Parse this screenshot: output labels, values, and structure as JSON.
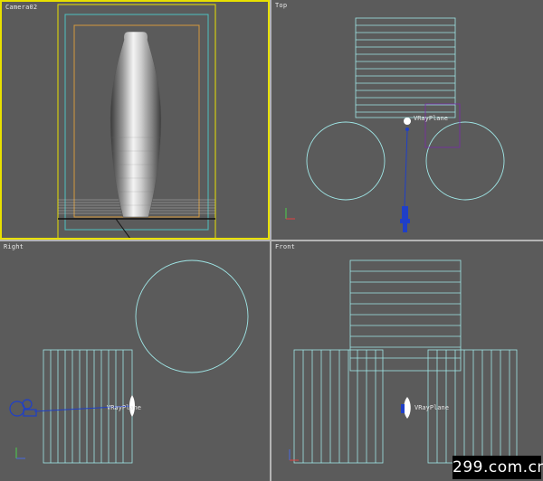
{
  "viewports": {
    "camera": {
      "label": "Camera02"
    },
    "top": {
      "label": "Top",
      "light_label": "VRayPlane"
    },
    "right": {
      "label": "Right",
      "light_label": "VRayPlane"
    },
    "front": {
      "label": "Front",
      "light_label": "VRayPlane"
    }
  },
  "watermark": "299.com.cn",
  "colors": {
    "viewport_bg": "#5b5b5b",
    "active_border": "#e8e000",
    "wireframe": "#9fe6e6",
    "safe_frame_outer": "#e8e000",
    "safe_frame_mid": "#4ec0c0",
    "safe_frame_inner": "#d49a3c",
    "light": "#1f3fc8",
    "light_target": "#7a2aa8"
  },
  "icons": [
    "axis-tripod-icon",
    "vray-light-icon",
    "camera-icon"
  ]
}
